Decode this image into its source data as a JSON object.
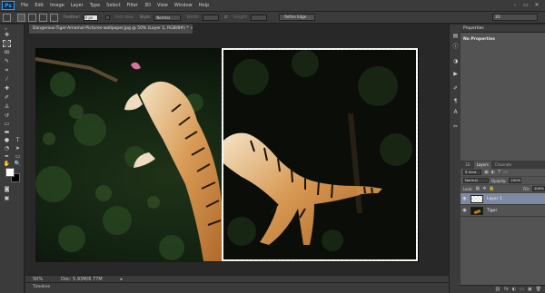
{
  "app": {
    "logo": "Ps"
  },
  "menu": [
    "File",
    "Edit",
    "Image",
    "Layer",
    "Type",
    "Select",
    "Filter",
    "3D",
    "View",
    "Window",
    "Help"
  ],
  "window_controls": [
    "–",
    "▭",
    "✕"
  ],
  "options": {
    "feather_label": "Feather:",
    "feather_value": "0 px",
    "anti_alias_label": "Anti-alias",
    "style_label": "Style:",
    "style_value": "Normal",
    "width_label": "Width:",
    "height_label": "Height:",
    "refine_edge": "Refine Edge...",
    "workspace": "3D"
  },
  "document": {
    "tab_title": "Dangerous-Tiger-Amamal-Pictures-wallpaper.jpg @ 50% (Layer 1, RGB/8#) *",
    "close": "×"
  },
  "status": {
    "zoom": "50%",
    "doc_size": "Doc: 5.93M/6.77M"
  },
  "timeline": {
    "label": "Timeline"
  },
  "properties": {
    "header": "Properties",
    "no_props": "No Properties"
  },
  "layers_panel": {
    "tabs": [
      "3D",
      "Layers",
      "Channels"
    ],
    "active_tab": "Layers",
    "kind_label": "Kind",
    "blend_mode": "Normal",
    "opacity_label": "Opacity:",
    "opacity_value": "100%",
    "lock_label": "Lock:",
    "fill_label": "Fill:",
    "fill_value": "100%",
    "layers": [
      {
        "name": "Layer 1",
        "selected": true
      },
      {
        "name": "Tiger",
        "selected": false
      }
    ],
    "bottom_icons": [
      "fx",
      "◐",
      "▭",
      "▣",
      "🗑"
    ]
  },
  "colors": {
    "foreground": "#ffffff",
    "background": "#000000",
    "selected_layer": "#7d8aa3",
    "ps_blue": "#2fa3f5"
  }
}
